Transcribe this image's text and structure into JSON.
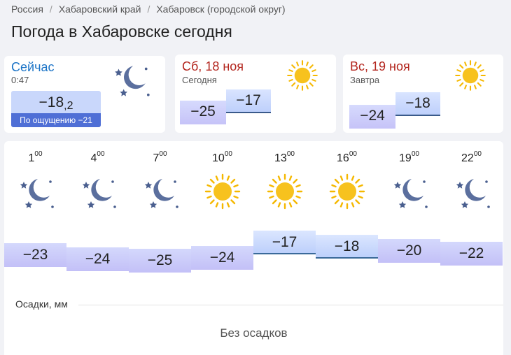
{
  "breadcrumbs": [
    "Россия",
    "Хабаровский край",
    "Хабаровск (городской округ)"
  ],
  "page_title": "Погода в Хабаровске сегодня",
  "now": {
    "label": "Сейчас",
    "time": "0:47",
    "temp_main": "−18",
    "temp_decimal": ",2",
    "feels_like": "По ощущению −21",
    "icon": "moon-stars-icon"
  },
  "today": {
    "day": "Сб,",
    "date": "18 ноя",
    "sub": "Сегодня",
    "min": "−25",
    "max": "−17",
    "icon": "sun-icon"
  },
  "tomorrow": {
    "day": "Вс,",
    "date": "19 ноя",
    "sub": "Завтра",
    "min": "−24",
    "max": "−18",
    "icon": "sun-icon"
  },
  "hourly": [
    {
      "hour": "1",
      "min": "00",
      "icon": "moon-stars-icon",
      "temp": "−23"
    },
    {
      "hour": "4",
      "min": "00",
      "icon": "moon-stars-icon",
      "temp": "−24"
    },
    {
      "hour": "7",
      "min": "00",
      "icon": "moon-stars-icon",
      "temp": "−25"
    },
    {
      "hour": "10",
      "min": "00",
      "icon": "sun-icon",
      "temp": "−24"
    },
    {
      "hour": "13",
      "min": "00",
      "icon": "sun-icon",
      "temp": "−17"
    },
    {
      "hour": "16",
      "min": "00",
      "icon": "sun-icon",
      "temp": "−18"
    },
    {
      "hour": "19",
      "min": "00",
      "icon": "moon-stars-icon",
      "temp": "−20"
    },
    {
      "hour": "22",
      "min": "00",
      "icon": "moon-stars-icon",
      "temp": "−22"
    }
  ],
  "precip": {
    "label": "Осадки, мм",
    "value": "Без осадков"
  },
  "colors": {
    "accent_blue": "#1a73c6",
    "date_red": "#b3261e",
    "feels_bg": "#4f6fd6",
    "sun": "#f5c518",
    "moon": "#5b6f9e"
  }
}
